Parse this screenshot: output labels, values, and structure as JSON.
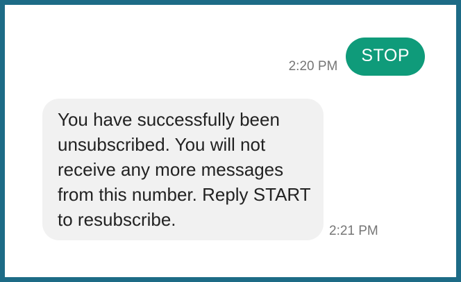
{
  "conversation": {
    "messages": [
      {
        "direction": "outgoing",
        "text": "STOP",
        "time": "2:20 PM"
      },
      {
        "direction": "incoming",
        "text": "You have successfully been unsubscribed. You will not receive any more messages from this number. Reply START to resubscribe.",
        "time": "2:21 PM"
      }
    ]
  },
  "colors": {
    "frame_border": "#1d6b86",
    "sent_bubble": "#0f9b7a",
    "received_bubble": "#f1f1f1",
    "timestamp": "#767676"
  }
}
